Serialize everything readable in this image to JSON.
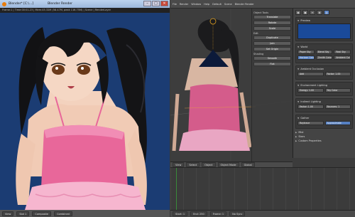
{
  "render_window": {
    "title": "Blender* [C:\\...]",
    "title_right": "Blender Render",
    "controls": {
      "minimize": "–",
      "maximize": "□",
      "close": "✕"
    },
    "infobar": "Frame:1 | Time:00:01.23 | Mem:45.32M (58.47M, peak 116.75M) | Scene | RenderLayer",
    "bottom": [
      "View",
      "Slot 1",
      "Composite",
      "Combined"
    ]
  },
  "blender": {
    "topbar": [
      "File",
      "Render",
      "Window",
      "Help",
      "Default",
      "Scene",
      "Blender Render"
    ],
    "tool_shelf": {
      "sections": [
        {
          "label": "Object Tools",
          "buttons": [
            "Translate",
            "Rotate",
            "Scale"
          ]
        },
        {
          "label": "Edit",
          "buttons": [
            "Duplicate",
            "Join",
            "Set Origin"
          ]
        },
        {
          "label": "Shading",
          "buttons": [
            "Smooth",
            "Flat"
          ]
        }
      ]
    },
    "properties": {
      "header_icons": [
        "camera-icon",
        "render-icon",
        "layers-icon",
        "scene-icon",
        "world-icon"
      ],
      "panels": [
        {
          "label": "Preview"
        },
        {
          "label": "World",
          "fields": [
            "Paper Sky",
            "Blend Sky",
            "Real Sky"
          ]
        },
        {
          "label": "Horizon Color",
          "fields": [
            "Zenith Color",
            "Ambient Color"
          ]
        },
        {
          "label": "Ambient Occlusion",
          "fields": [
            "Add",
            "Factor: 1.00"
          ]
        },
        {
          "label": "Environment Lighting",
          "fields": [
            "Energy: 1.00",
            "Sky Color"
          ]
        },
        {
          "label": "Indirect Lighting",
          "fields": [
            "Factor: 1.00",
            "Bounces: 1"
          ]
        },
        {
          "label": "Gather",
          "fields": [
            "Raytrace",
            "Approximate"
          ]
        },
        {
          "label": "Mist"
        },
        {
          "label": "Stars"
        },
        {
          "label": "Custom Properties"
        }
      ]
    },
    "header_items": [
      "View",
      "Select",
      "Object",
      "Object Mode",
      "Global"
    ],
    "status": [
      "Start: 1",
      "End: 250",
      "Frame: 1",
      "No Sync"
    ]
  },
  "colors": {
    "render_bg": "#1b3c73",
    "swimsuit": "#e8679a",
    "world_swatch": "#1a4a9a",
    "accent": "#5680c2"
  }
}
